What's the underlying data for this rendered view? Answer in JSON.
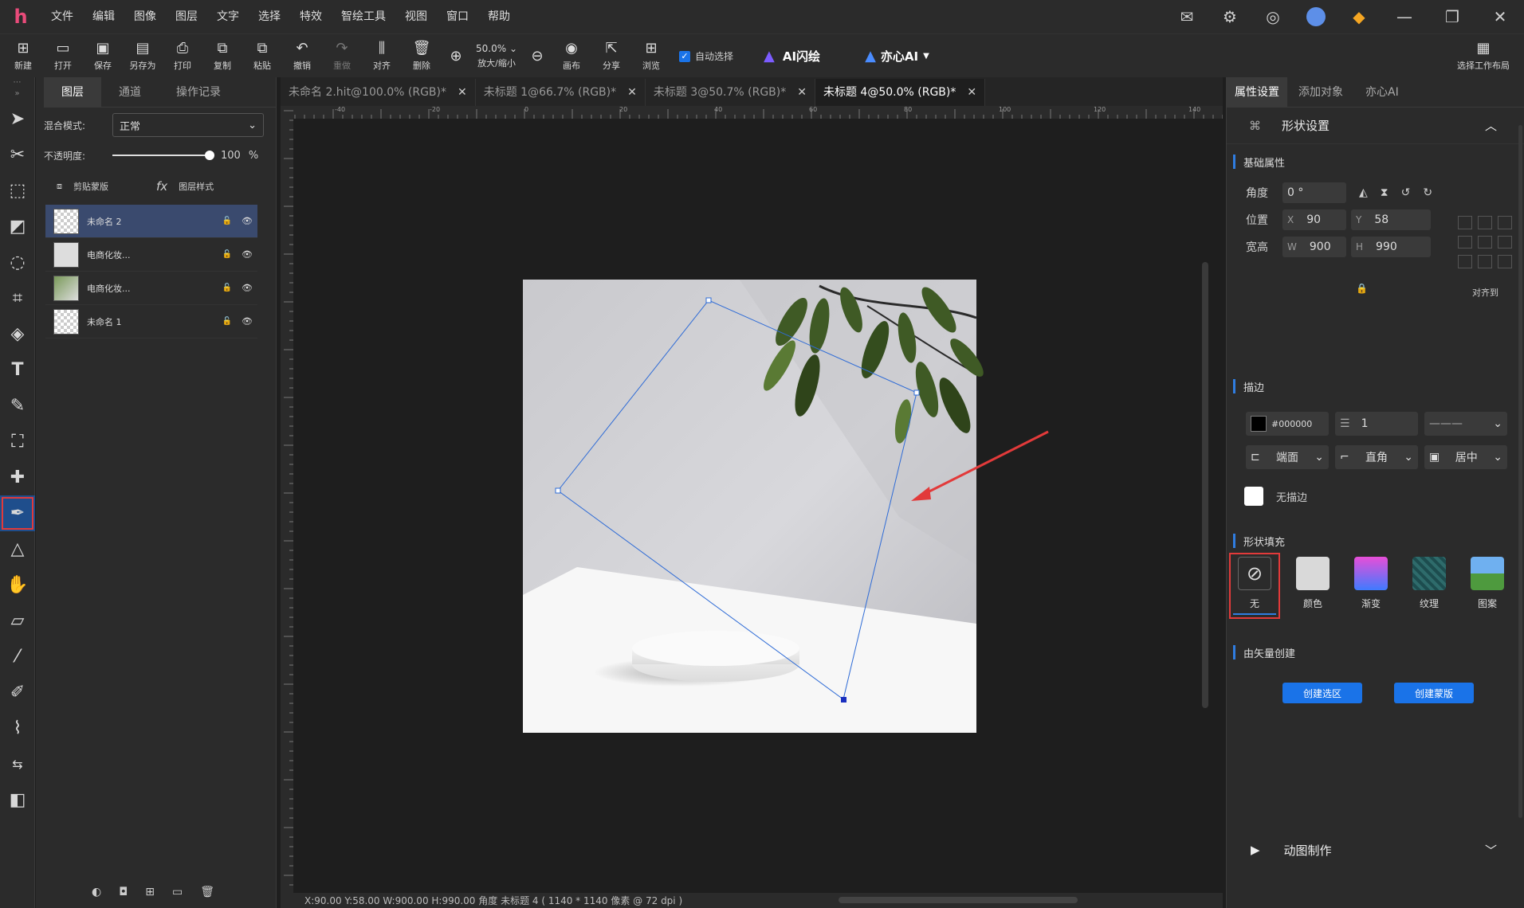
{
  "menubar": {
    "logo": "h",
    "items": [
      "文件",
      "编辑",
      "图像",
      "图层",
      "文字",
      "选择",
      "特效",
      "智绘工具",
      "视图",
      "窗口",
      "帮助"
    ]
  },
  "toolbar": {
    "buttons": [
      {
        "label": "新建",
        "icon": "new-file-icon",
        "glyph": "⊞"
      },
      {
        "label": "打开",
        "icon": "folder-icon",
        "glyph": "📂"
      },
      {
        "label": "保存",
        "icon": "save-icon",
        "glyph": "🖫"
      },
      {
        "label": "另存为",
        "icon": "save-as-icon",
        "glyph": "🗎"
      },
      {
        "label": "打印",
        "icon": "print-icon",
        "glyph": "⎙"
      },
      {
        "label": "复制",
        "icon": "copy-icon",
        "glyph": "⧉"
      },
      {
        "label": "粘贴",
        "icon": "paste-icon",
        "glyph": "⧉"
      },
      {
        "label": "撤销",
        "icon": "undo-icon",
        "glyph": "↶"
      },
      {
        "label": "重做",
        "icon": "redo-icon",
        "glyph": "↷"
      },
      {
        "label": "对齐",
        "icon": "align-icon",
        "glyph": "⫼"
      },
      {
        "label": "删除",
        "icon": "trash-icon",
        "glyph": "🗑"
      }
    ],
    "zoom_value": "50.0%",
    "zoom_label": "放大/缩小",
    "canvas_label": "画布",
    "share_label": "分享",
    "browse_label": "浏览",
    "auto_select": "自动选择",
    "ai_flash": "AI闪绘",
    "yixin_ai": "亦心AI",
    "workspace_label": "选择工作布局"
  },
  "layers_panel": {
    "tabs": [
      "图层",
      "通道",
      "操作记录"
    ],
    "blend_label": "混合模式:",
    "blend_value": "正常",
    "opacity_label": "不透明度:",
    "opacity_value": "100",
    "opacity_unit": "%",
    "opacity_level": 1.0,
    "clip_mask": "剪贴蒙版",
    "layer_style": "图层样式",
    "layers": [
      {
        "name": "未命名 2",
        "selected": true
      },
      {
        "name": "电商化妆...",
        "selected": false
      },
      {
        "name": "电商化妆...",
        "selected": false
      },
      {
        "name": "未命名 1",
        "selected": false
      }
    ]
  },
  "doc_tabs": [
    {
      "label": "未命名 2.hit@100.0% (RGB)*",
      "active": false
    },
    {
      "label": "未标题 1@66.7% (RGB)*",
      "active": false
    },
    {
      "label": "未标题 3@50.7% (RGB)*",
      "active": false
    },
    {
      "label": "未标题 4@50.0% (RGB)*",
      "active": true
    }
  ],
  "ruler": {
    "h_ticks": [
      "-40",
      "-20",
      "0",
      "20",
      "40",
      "60",
      "80",
      "100",
      "120",
      "140"
    ]
  },
  "status": {
    "text": "X:90.00 Y:58.00 W:900.00 H:990.00 角度  未标题 4 ( 1140 * 1140 像素 @ 72 dpi )"
  },
  "right_panel": {
    "tabs": [
      "属性设置",
      "添加对象",
      "亦心AI"
    ],
    "header": "形状设置",
    "basic_title": "基础属性",
    "angle_label": "角度",
    "angle_value": "0 °",
    "pos_label": "位置",
    "x_key": "X",
    "x_value": "90",
    "y_key": "Y",
    "y_value": "58",
    "size_label": "宽高",
    "w_key": "W",
    "w_value": "900",
    "h_key": "H",
    "h_value": "990",
    "align_to": "对齐到",
    "stroke_title": "描边",
    "stroke_color": "#000000",
    "stroke_width": "1",
    "cap_value": "端面",
    "join_value": "直角",
    "align_value": "居中",
    "no_stroke": "无描边",
    "fill_title": "形状填充",
    "fill_options": [
      {
        "label": "无",
        "color": "#2b2b2b"
      },
      {
        "label": "颜色",
        "color": "#d9d9d9"
      },
      {
        "label": "渐变",
        "color": "#b94df0"
      },
      {
        "label": "纹理",
        "color": "#2e6b6b"
      },
      {
        "label": "图案",
        "color": "#5a9ad8"
      }
    ],
    "vector_title": "由矢量创建",
    "create_selection": "创建选区",
    "create_mask": "创建蒙版",
    "animation": "动图制作"
  }
}
